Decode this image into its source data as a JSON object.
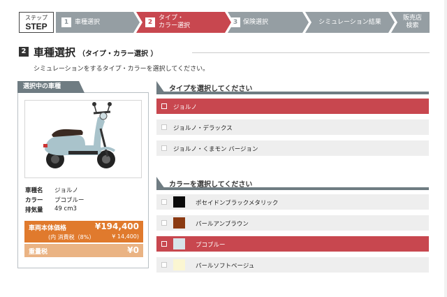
{
  "stepbar": {
    "step_label_small": "ステップ",
    "step_label_big": "STEP",
    "steps": [
      {
        "num": "1",
        "label": "車種選択",
        "active": false
      },
      {
        "num": "2",
        "label_line1": "タイプ・",
        "label_line2": "カラー選択",
        "active": true
      },
      {
        "num": "3",
        "label": "保険選択",
        "active": false
      },
      {
        "label": "シミュレーション結果",
        "active": false
      },
      {
        "label_line1": "販売店",
        "label_line2": "検索",
        "active": false
      }
    ]
  },
  "heading": {
    "badge": "2",
    "title": "車種選択",
    "subtitle": "（タイプ・カラー選択 ）",
    "lead": "シミュレーションをするタイプ・カラーを選択してください。"
  },
  "selected_vehicle": {
    "tab": "選択中の車種",
    "specs": [
      {
        "key": "車種名",
        "value": "ジョルノ"
      },
      {
        "key": "カラー",
        "value": "プコブルー"
      },
      {
        "key": "排気量",
        "value": "49 cm3"
      }
    ],
    "price_label": "車両本体価格",
    "price_value": "¥194,400",
    "tax_label": "(内 消費税（8%）",
    "tax_value": "¥ 14,400)",
    "weight_tax_label": "重量税",
    "weight_tax_value": "¥0"
  },
  "type_section": {
    "title": "タイプを選択してください",
    "options": [
      {
        "label": "ジョルノ",
        "selected": true
      },
      {
        "label": "ジョルノ・デラックス",
        "selected": false
      },
      {
        "label": "ジョルノ・くまモン バージョン",
        "selected": false
      }
    ]
  },
  "color_section": {
    "title": "カラーを選択してください",
    "options": [
      {
        "label": "ポセイドンブラックメタリック",
        "swatch": "#0a0a0a",
        "selected": false
      },
      {
        "label": "パールアンブラウン",
        "swatch": "#8b3a12",
        "selected": false
      },
      {
        "label": "プコブルー",
        "swatch": "#d8e4ea",
        "selected": true
      },
      {
        "label": "パールソフトベージュ",
        "swatch": "#fbf6d2",
        "selected": false
      }
    ]
  },
  "colors": {
    "accent_red": "#c8474f",
    "step_gray": "#959ea3",
    "price_orange": "#e07a2d",
    "weight_orange": "#eab383",
    "header_slate": "#6f7c82"
  }
}
